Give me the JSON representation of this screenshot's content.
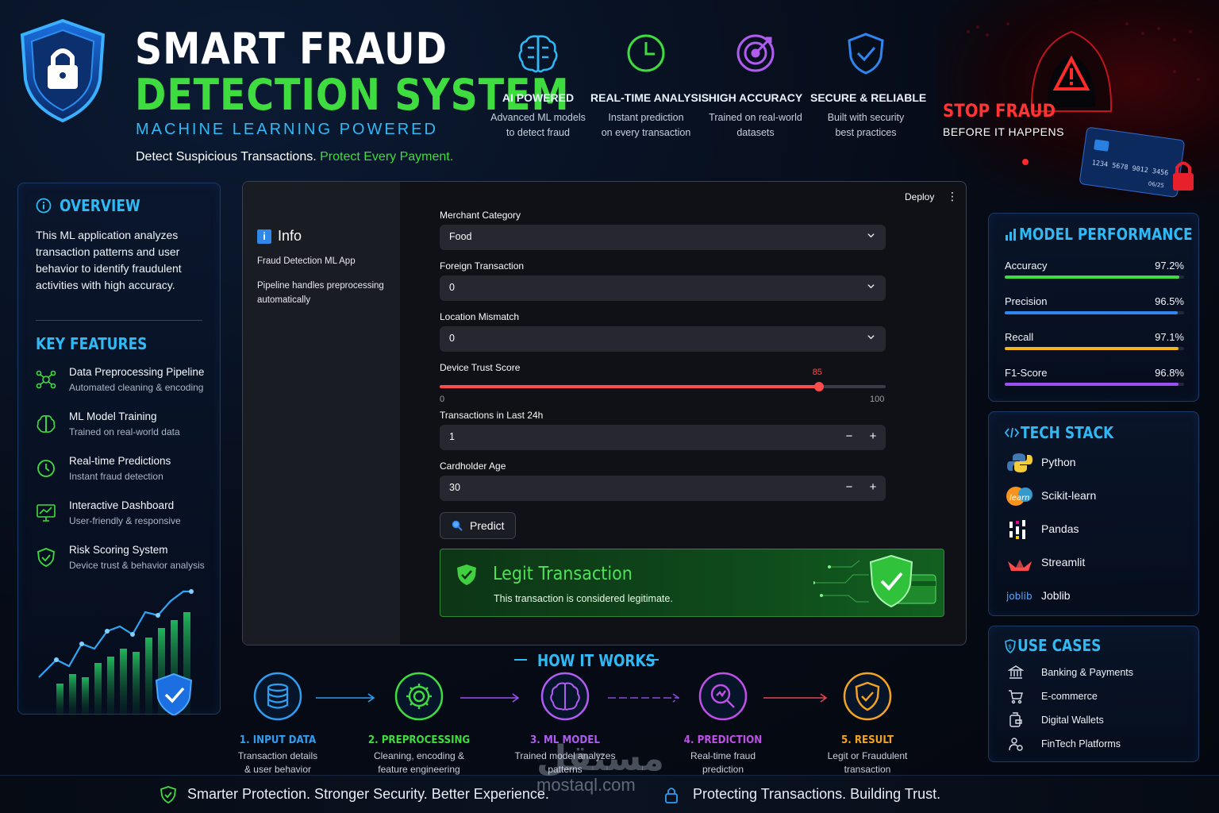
{
  "header": {
    "title_line1": "SMART FRAUD",
    "title_line2": "DETECTION SYSTEM",
    "subtitle": "MACHINE LEARNING POWERED",
    "tagline_main": "Detect Suspicious Transactions.",
    "tagline_accent": "Protect Every Payment."
  },
  "features": [
    {
      "icon": "brain-icon",
      "title": "AI POWERED",
      "line1": "Advanced ML models",
      "line2": "to detect fraud",
      "color": "#2fb9f5"
    },
    {
      "icon": "clock-icon",
      "title": "REAL-TIME ANALYSIS",
      "line1": "Instant prediction",
      "line2": "on every transaction",
      "color": "#3fdc3f"
    },
    {
      "icon": "target-icon",
      "title": "HIGH ACCURACY",
      "line1": "Trained on real-world",
      "line2": "datasets",
      "color": "#b05cf0"
    },
    {
      "icon": "shield-check-icon",
      "title": "SECURE & RELIABLE",
      "line1": "Built with security",
      "line2": "best practices",
      "color": "#2f86f0"
    }
  ],
  "stop_fraud": {
    "line1": "STOP FRAUD",
    "line2": "BEFORE IT HAPPENS",
    "card_number": "1234 5678 9012 3456",
    "card_expiry": "06/25"
  },
  "overview": {
    "heading": "OVERVIEW",
    "text": "This ML application analyzes transaction patterns and user behavior to identify fraudulent activities with high accuracy.",
    "features_heading": "KEY FEATURES",
    "items": [
      {
        "title": "Data Preprocessing Pipeline",
        "desc": "Automated cleaning & encoding",
        "icon": "pipeline-icon"
      },
      {
        "title": "ML Model Training",
        "desc": "Trained on real-world data",
        "icon": "brain-icon"
      },
      {
        "title": "Real-time Predictions",
        "desc": "Instant fraud detection",
        "icon": "clock-icon"
      },
      {
        "title": "Interactive Dashboard",
        "desc": "User-friendly & responsive",
        "icon": "monitor-chart-icon"
      },
      {
        "title": "Risk Scoring System",
        "desc": "Device trust & behavior analysis",
        "icon": "shield-check-icon"
      }
    ]
  },
  "app": {
    "deploy_label": "Deploy",
    "menu_label": "⋮",
    "sidebar": {
      "heading": "Info",
      "line1": "Fraud Detection ML App",
      "line2": "Pipeline handles preprocessing automatically"
    },
    "fields": {
      "merchant_category": {
        "label": "Merchant Category",
        "value": "Food"
      },
      "foreign_transaction": {
        "label": "Foreign Transaction",
        "value": "0"
      },
      "location_mismatch": {
        "label": "Location Mismatch",
        "value": "0"
      },
      "device_trust": {
        "label": "Device Trust Score",
        "value": 85,
        "min": 0,
        "max": 100,
        "value_text": "85",
        "min_text": "0",
        "max_text": "100"
      },
      "transactions_24h": {
        "label": "Transactions in Last 24h",
        "value": "1"
      },
      "cardholder_age": {
        "label": "Cardholder Age",
        "value": "30"
      }
    },
    "stepper": {
      "minus": "−",
      "plus": "+"
    },
    "predict_label": "Predict",
    "result": {
      "title": "Legit Transaction",
      "desc": "This transaction is considered legitimate."
    }
  },
  "performance": {
    "heading": "MODEL PERFORMANCE",
    "metrics": [
      {
        "name": "Accuracy",
        "value": 97.2,
        "value_text": "97.2%",
        "color": "#3fdc3f"
      },
      {
        "name": "Precision",
        "value": 96.5,
        "value_text": "96.5%",
        "color": "#2f86f0"
      },
      {
        "name": "Recall",
        "value": 97.1,
        "value_text": "97.1%",
        "color": "#f4b321"
      },
      {
        "name": "F1-Score",
        "value": 96.8,
        "value_text": "96.8%",
        "color": "#9b4ff0"
      }
    ]
  },
  "tech_stack": {
    "heading": "TECH STACK",
    "items": [
      {
        "name": "Python",
        "icon": "python-icon"
      },
      {
        "name": "Scikit-learn",
        "icon": "scikit-learn-icon",
        "badge": "learn"
      },
      {
        "name": "Pandas",
        "icon": "pandas-icon"
      },
      {
        "name": "Streamlit",
        "icon": "streamlit-icon"
      },
      {
        "name": "Joblib",
        "icon": "joblib-icon",
        "badge": "joblib"
      }
    ]
  },
  "use_cases": {
    "heading": "USE CASES",
    "items": [
      {
        "name": "Banking & Payments",
        "icon": "bank-icon"
      },
      {
        "name": "E-commerce",
        "icon": "cart-icon"
      },
      {
        "name": "Digital Wallets",
        "icon": "wallet-icon"
      },
      {
        "name": "FinTech Platforms",
        "icon": "fintech-icon"
      }
    ]
  },
  "how_it_works": {
    "heading": "HOW IT WORKS",
    "steps": [
      {
        "title": "1. INPUT DATA",
        "line1": "Transaction details",
        "line2": "& user behavior",
        "color": "#2f9ef0",
        "icon": "database-icon"
      },
      {
        "title": "2. PREPROCESSING",
        "line1": "Cleaning, encoding &",
        "line2": "feature engineering",
        "color": "#3fdc3f",
        "icon": "gear-icon"
      },
      {
        "title": "3. ML MODEL",
        "line1": "Trained model analyzes",
        "line2": "patterns",
        "color": "#b05cf0",
        "icon": "brain-icon"
      },
      {
        "title": "4. PREDICTION",
        "line1": "Real-time fraud",
        "line2": "prediction",
        "color": "#c04fe8",
        "icon": "magnifier-icon"
      },
      {
        "title": "5. RESULT",
        "line1": "Legit or Fraudulent",
        "line2": "transaction",
        "color": "#f4a321",
        "icon": "shield-check-icon"
      }
    ]
  },
  "footer": {
    "left": "Smarter Protection. Stronger Security. Better Experience.",
    "right": "Protecting Transactions. Building Trust."
  },
  "watermark": {
    "arabic": "مستقل",
    "latin": "mostaql.com"
  }
}
